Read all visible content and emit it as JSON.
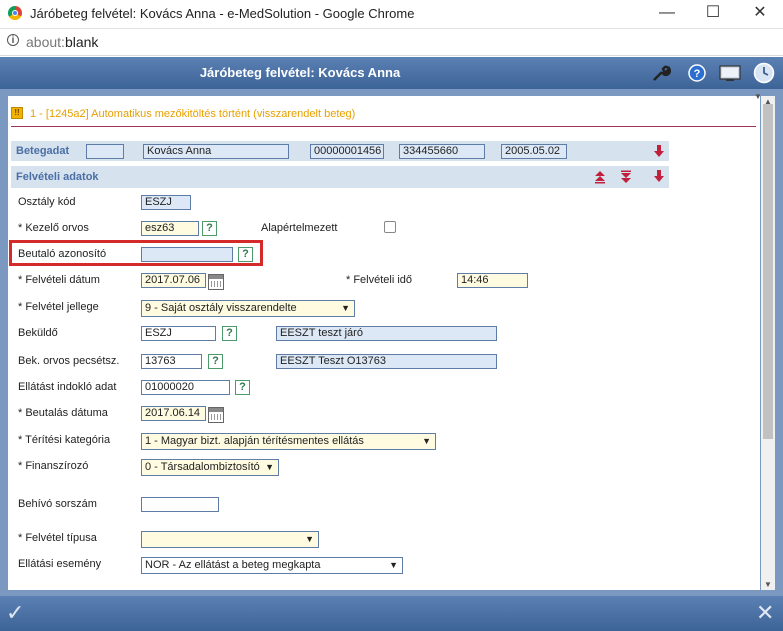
{
  "window": {
    "title": "Járóbeteg felvétel: Kovács Anna - e-MedSolution - Google Chrome",
    "minimize": "—",
    "maximize": "☐",
    "close": "✕"
  },
  "address": {
    "scheme": "about:",
    "rest": "blank"
  },
  "app": {
    "title": "Járóbeteg felvétel: Kovács Anna"
  },
  "message": {
    "icon": "!!",
    "text": "1 - [1245a2] Automatikus mezőkitöltés történt (visszarendelt beteg)"
  },
  "betegadat": {
    "label": "Betegadat",
    "blank": "",
    "name": "Kovács Anna",
    "id1": "00000001456",
    "id2": "334455660",
    "date": "2005.05.02"
  },
  "felveteli": {
    "label": "Felvételi adatok"
  },
  "form": {
    "osztaly_kod": {
      "label": "Osztály kód",
      "value": "ESZJ"
    },
    "kezelo_orvos": {
      "label": "* Kezelő orvos",
      "value": "esz63",
      "help": "?",
      "alapertelmezett": "Alapértelmezett"
    },
    "beutalo": {
      "label": "Beutaló azonosító",
      "value": "",
      "help": "?"
    },
    "felveteli_datum": {
      "label": "* Felvételi dátum",
      "value": "2017.07.06",
      "ido_label": "* Felvételi idő",
      "ido_value": "14:46"
    },
    "felvetel_jellege": {
      "label": "* Felvétel jellege",
      "value": "9 - Saját osztály visszarendelte"
    },
    "bekuldo": {
      "label": "Beküldő",
      "value": "ESZJ",
      "help": "?",
      "desc": "EESZT teszt járó"
    },
    "bek_orvos": {
      "label": "Bek. orvos pecsétsz.",
      "value": "13763",
      "help": "?",
      "desc": "EESZT Teszt O13763"
    },
    "ellatast": {
      "label": "Ellátást indokló adat",
      "value": "01000020",
      "help": "?"
    },
    "beutalas_datuma": {
      "label": "* Beutalás dátuma",
      "value": "2017.06.14"
    },
    "teritesi": {
      "label": "* Térítési kategória",
      "value": "1 - Magyar bizt. alapján térítésmentes ellátás"
    },
    "finanszirozo": {
      "label": "* Finanszírozó",
      "value": "0 - Társadalombiztosító"
    },
    "behivo": {
      "label": "Behívó sorszám",
      "value": ""
    },
    "felvetel_tipusa": {
      "label": "* Felvétel típusa",
      "value": ""
    },
    "ellatasi_esemeny": {
      "label": "Ellátási esemény",
      "value": "NOR - Az ellátást a beteg megkapta"
    }
  },
  "dropdown_arrow": "▼",
  "footer": {
    "ok": "✓",
    "cancel": "✕"
  },
  "colors": {
    "header": "#4a6fa5",
    "highlight": "#d42a2a",
    "message": "#e8a000"
  }
}
